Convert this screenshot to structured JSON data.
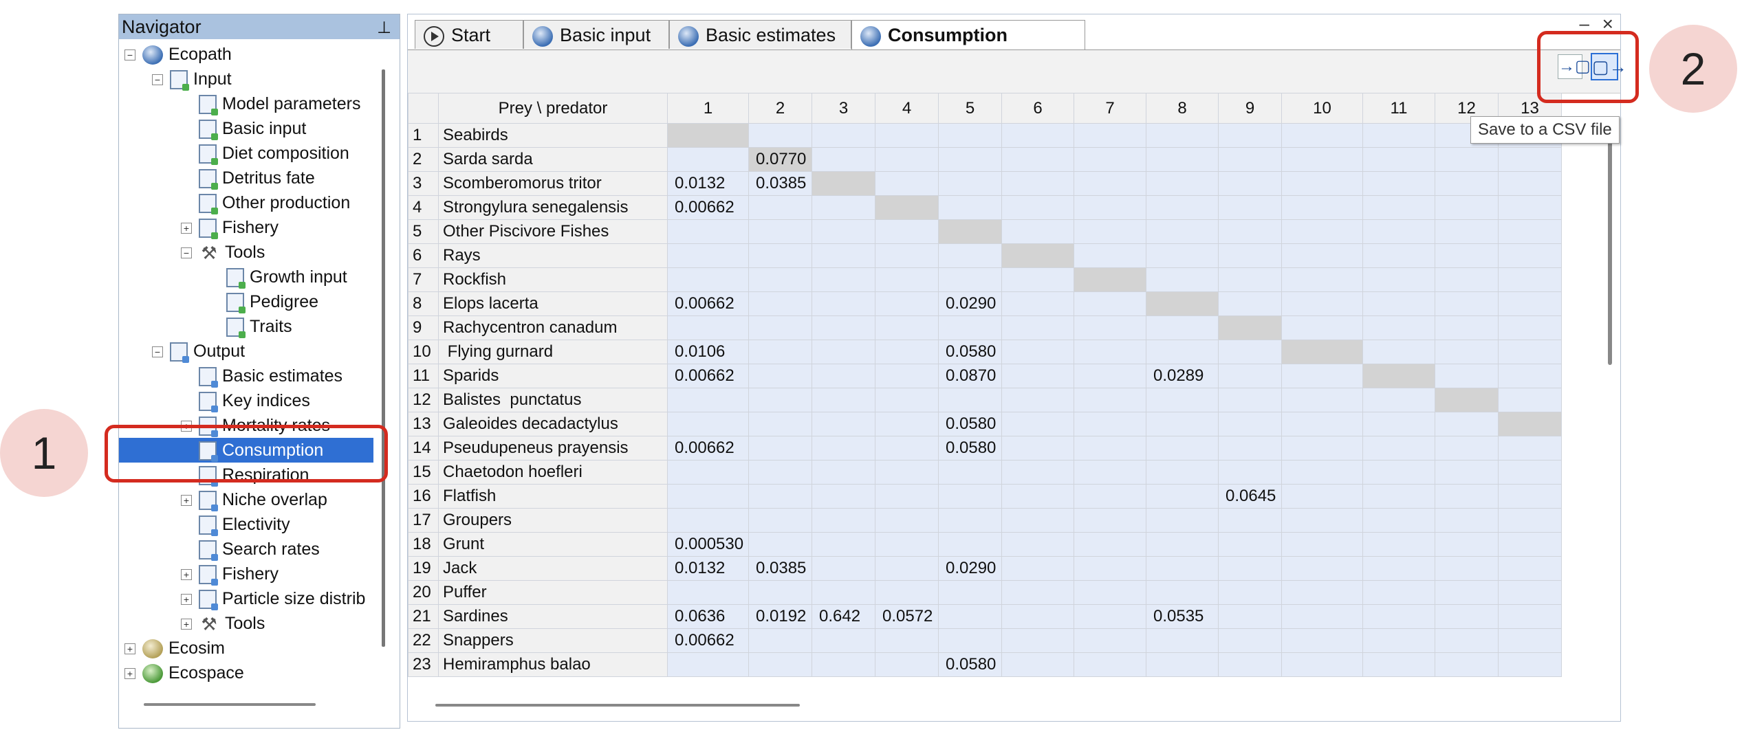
{
  "navigator": {
    "title": "Navigator",
    "pin_icon": "pin-icon",
    "tree": [
      {
        "label": "Ecopath",
        "level": 0,
        "expander": "⊟",
        "icon": "globe"
      },
      {
        "label": "Input",
        "level": 1,
        "expander": "⊟",
        "icon": "page"
      },
      {
        "label": "Model parameters",
        "level": 2,
        "icon": "page"
      },
      {
        "label": "Basic input",
        "level": 2,
        "icon": "page"
      },
      {
        "label": "Diet composition",
        "level": 2,
        "icon": "page"
      },
      {
        "label": "Detritus fate",
        "level": 2,
        "icon": "page"
      },
      {
        "label": "Other production",
        "level": 2,
        "icon": "page"
      },
      {
        "label": "Fishery",
        "level": 2,
        "expander": "⊞",
        "icon": "page"
      },
      {
        "label": "Tools",
        "level": 2,
        "expander": "⊟",
        "icon": "tool"
      },
      {
        "label": "Growth input",
        "level": 3,
        "icon": "page"
      },
      {
        "label": "Pedigree",
        "level": 3,
        "icon": "page"
      },
      {
        "label": "Traits",
        "level": 3,
        "icon": "page"
      },
      {
        "label": "Output",
        "level": 1,
        "expander": "⊟",
        "icon": "out"
      },
      {
        "label": "Basic estimates",
        "level": 2,
        "icon": "out"
      },
      {
        "label": "Key indices",
        "level": 2,
        "icon": "out"
      },
      {
        "label": "Mortality rates",
        "level": 2,
        "expander": "⊞",
        "icon": "out"
      },
      {
        "label": "Consumption",
        "level": 2,
        "icon": "out",
        "selected": true
      },
      {
        "label": "Respiration",
        "level": 2,
        "icon": "out"
      },
      {
        "label": "Niche overlap",
        "level": 2,
        "expander": "⊞",
        "icon": "out"
      },
      {
        "label": "Electivity",
        "level": 2,
        "icon": "out"
      },
      {
        "label": "Search rates",
        "level": 2,
        "icon": "out"
      },
      {
        "label": "Fishery",
        "level": 2,
        "expander": "⊞",
        "icon": "out"
      },
      {
        "label": "Particle size distrib",
        "level": 2,
        "expander": "⊞",
        "icon": "out"
      },
      {
        "label": "Tools",
        "level": 2,
        "expander": "⊞",
        "icon": "tool"
      },
      {
        "label": "Ecosim",
        "level": 0,
        "expander": "⊞",
        "icon": "sim"
      },
      {
        "label": "Ecospace",
        "level": 0,
        "expander": "⊞",
        "icon": "space"
      }
    ]
  },
  "tabs": [
    {
      "label": "Start",
      "icon": "play-icon"
    },
    {
      "label": "Basic input",
      "icon": "ecopath-icon"
    },
    {
      "label": "Basic estimates",
      "icon": "ecopath-icon"
    },
    {
      "label": "Consumption",
      "icon": "ecopath-icon",
      "active": true
    }
  ],
  "window": {
    "minimize": "–",
    "close": "×"
  },
  "toolbar": {
    "import_icon": "→▢",
    "export_icon": "▢→",
    "tooltip": "Save to a CSV file"
  },
  "grid": {
    "corner_header": "Prey \\ predator",
    "columns": [
      "1",
      "2",
      "3",
      "4",
      "5",
      "6",
      "7",
      "8",
      "9",
      "10",
      "11",
      "12",
      "13"
    ],
    "rows": [
      {
        "n": "1",
        "name": "Seabirds",
        "cells": [
          "",
          "",
          "",
          "",
          "",
          "",
          "",
          "",
          "",
          "",
          "",
          "",
          ""
        ]
      },
      {
        "n": "2",
        "name": "Sarda sarda",
        "cells": [
          "",
          "0.0770",
          "",
          "",
          "",
          "",
          "",
          "",
          "",
          "",
          "",
          "",
          ""
        ]
      },
      {
        "n": "3",
        "name": "Scomberomorus tritor",
        "cells": [
          "0.0132",
          "0.0385",
          "",
          "",
          "",
          "",
          "",
          "",
          "",
          "",
          "",
          "",
          ""
        ]
      },
      {
        "n": "4",
        "name": "Strongylura senegalensis",
        "cells": [
          "0.00662",
          "",
          "",
          "",
          "",
          "",
          "",
          "",
          "",
          "",
          "",
          "",
          ""
        ]
      },
      {
        "n": "5",
        "name": "Other Piscivore Fishes",
        "cells": [
          "",
          "",
          "",
          "",
          "",
          "",
          "",
          "",
          "",
          "",
          "",
          "",
          ""
        ]
      },
      {
        "n": "6",
        "name": "Rays",
        "cells": [
          "",
          "",
          "",
          "",
          "",
          "",
          "",
          "",
          "",
          "",
          "",
          "",
          ""
        ]
      },
      {
        "n": "7",
        "name": "Rockfish",
        "cells": [
          "",
          "",
          "",
          "",
          "",
          "",
          "",
          "",
          "",
          "",
          "",
          "",
          ""
        ]
      },
      {
        "n": "8",
        "name": "Elops lacerta",
        "cells": [
          "0.00662",
          "",
          "",
          "",
          "0.0290",
          "",
          "",
          "",
          "",
          "",
          "",
          "",
          ""
        ]
      },
      {
        "n": "9",
        "name": "Rachycentron canadum",
        "cells": [
          "",
          "",
          "",
          "",
          "",
          "",
          "",
          "",
          "",
          "",
          "",
          "",
          ""
        ]
      },
      {
        "n": "10",
        "name": " Flying gurnard",
        "cells": [
          "0.0106",
          "",
          "",
          "",
          "0.0580",
          "",
          "",
          "",
          "",
          "",
          "",
          "",
          ""
        ]
      },
      {
        "n": "11",
        "name": "Sparids",
        "cells": [
          "0.00662",
          "",
          "",
          "",
          "0.0870",
          "",
          "",
          "0.0289",
          "",
          "",
          "",
          "",
          ""
        ]
      },
      {
        "n": "12",
        "name": "Balistes  punctatus",
        "cells": [
          "",
          "",
          "",
          "",
          "",
          "",
          "",
          "",
          "",
          "",
          "",
          "",
          ""
        ]
      },
      {
        "n": "13",
        "name": "Galeoides decadactylus",
        "cells": [
          "",
          "",
          "",
          "",
          "0.0580",
          "",
          "",
          "",
          "",
          "",
          "",
          "",
          ""
        ]
      },
      {
        "n": "14",
        "name": "Pseudupeneus prayensis",
        "cells": [
          "0.00662",
          "",
          "",
          "",
          "0.0580",
          "",
          "",
          "",
          "",
          "",
          "",
          "",
          ""
        ]
      },
      {
        "n": "15",
        "name": "Chaetodon hoefleri",
        "cells": [
          "",
          "",
          "",
          "",
          "",
          "",
          "",
          "",
          "",
          "",
          "",
          "",
          ""
        ]
      },
      {
        "n": "16",
        "name": "Flatfish",
        "cells": [
          "",
          "",
          "",
          "",
          "",
          "",
          "",
          "",
          "0.0645",
          "",
          "",
          "",
          ""
        ]
      },
      {
        "n": "17",
        "name": "Groupers",
        "cells": [
          "",
          "",
          "",
          "",
          "",
          "",
          "",
          "",
          "",
          "",
          "",
          "",
          ""
        ]
      },
      {
        "n": "18",
        "name": "Grunt",
        "cells": [
          "0.000530",
          "",
          "",
          "",
          "",
          "",
          "",
          "",
          "",
          "",
          "",
          "",
          ""
        ]
      },
      {
        "n": "19",
        "name": "Jack",
        "cells": [
          "0.0132",
          "0.0385",
          "",
          "",
          "0.0290",
          "",
          "",
          "",
          "",
          "",
          "",
          "",
          ""
        ]
      },
      {
        "n": "20",
        "name": "Puffer",
        "cells": [
          "",
          "",
          "",
          "",
          "",
          "",
          "",
          "",
          "",
          "",
          "",
          "",
          ""
        ]
      },
      {
        "n": "21",
        "name": "Sardines",
        "cells": [
          "0.0636",
          "0.0192",
          "0.642",
          "0.0572",
          "",
          "",
          "",
          "0.0535",
          "",
          "",
          "",
          "",
          ""
        ]
      },
      {
        "n": "22",
        "name": "Snappers",
        "cells": [
          "0.00662",
          "",
          "",
          "",
          "",
          "",
          "",
          "",
          "",
          "",
          "",
          "",
          ""
        ]
      },
      {
        "n": "23",
        "name": "Hemiramphus balao",
        "cells": [
          "",
          "",
          "",
          "",
          "0.0580",
          "",
          "",
          "",
          "",
          "",
          "",
          "",
          ""
        ]
      }
    ]
  },
  "annotations": {
    "marker1": "1",
    "marker2": "2"
  },
  "colors": {
    "selection": "#2f6fd3",
    "highlight": "#d42b1f",
    "cell_bg": "#e4ebf8",
    "diagonal": "#d3d3d3"
  }
}
